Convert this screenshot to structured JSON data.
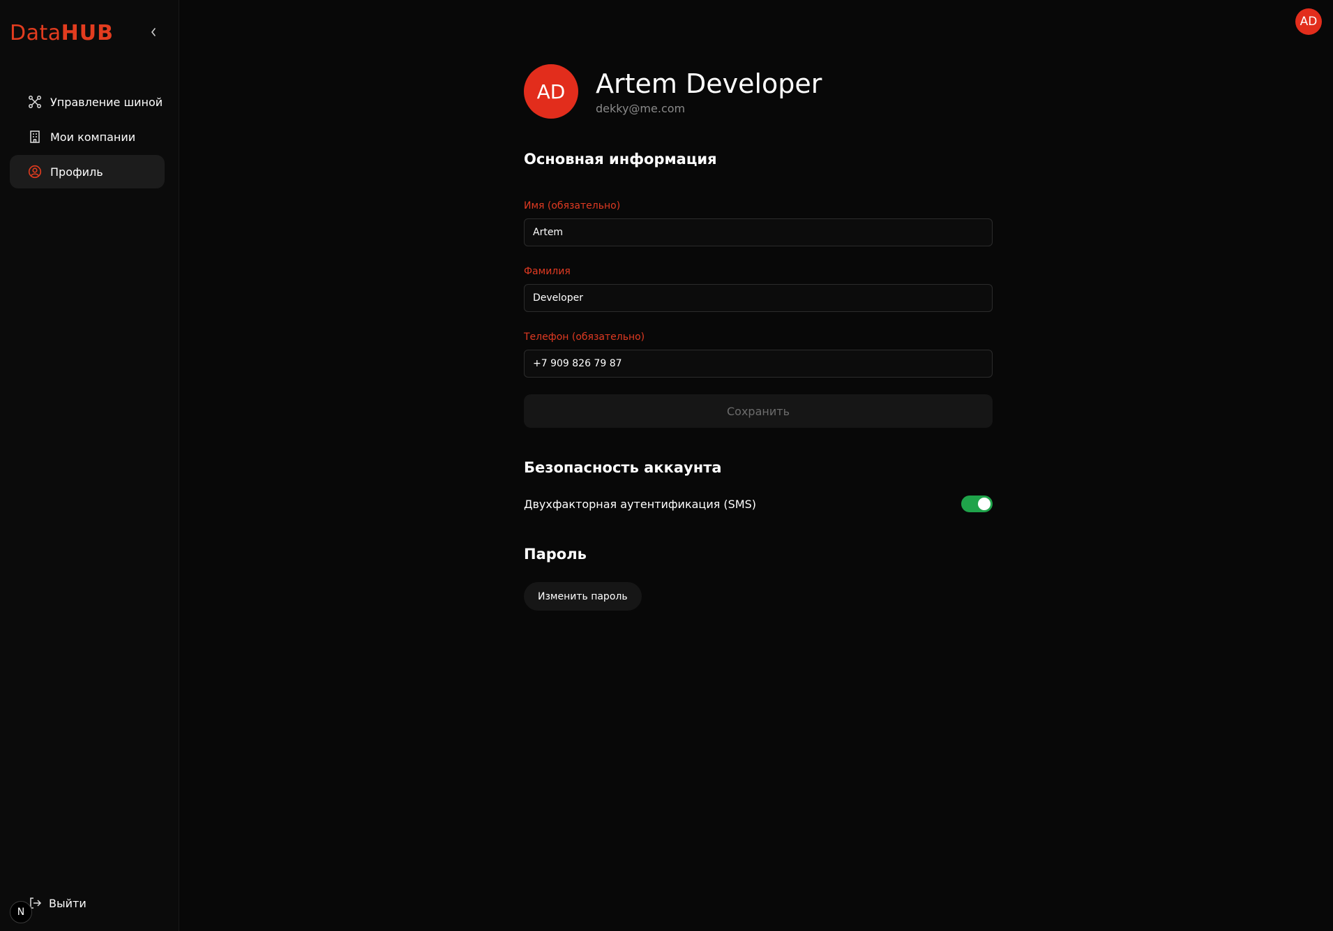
{
  "sidebar": {
    "logo_data": "Data",
    "logo_hub": "HUB",
    "collapse_icon": "chevron-left",
    "items": [
      {
        "label": "Управление шиной",
        "icon": "bus-network-icon",
        "active": false
      },
      {
        "label": "Мои компании",
        "icon": "building-icon",
        "active": false
      },
      {
        "label": "Профиль",
        "icon": "user-circle-icon",
        "active": true
      }
    ],
    "logout_label": "Выйти",
    "next_badge": "N"
  },
  "header": {
    "avatar_initials": "AD"
  },
  "profile": {
    "initials": "AD",
    "full_name": "Artem Developer",
    "email": "dekky@me.com"
  },
  "basic_info": {
    "title": "Основная информация",
    "first_name_label": "Имя (обязательно)",
    "first_name_value": "Artem",
    "last_name_label": "Фамилия",
    "last_name_value": "Developer",
    "phone_label": "Телефон (обязательно)",
    "phone_value": "+7 909 826 79 87",
    "save_label": "Сохранить"
  },
  "security": {
    "title": "Безопасность аккаунта",
    "twofa_label": "Двухфакторная аутентификация (SMS)",
    "twofa_enabled": true
  },
  "password": {
    "title": "Пароль",
    "change_label": "Изменить пароль"
  },
  "colors": {
    "accent": "#e22d1c",
    "toggle_on": "#1fa34a",
    "background": "#080808"
  }
}
